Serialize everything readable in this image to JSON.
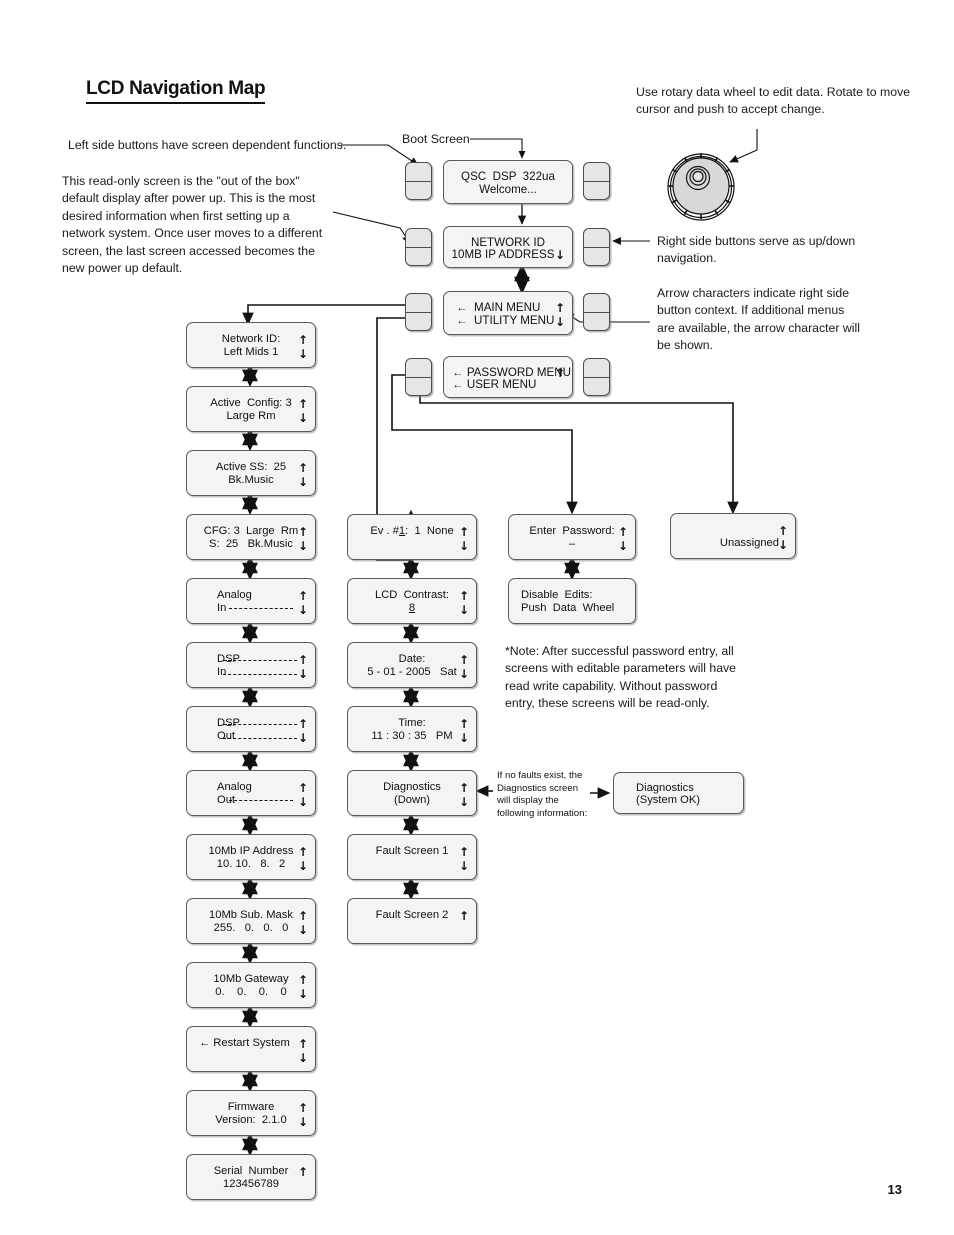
{
  "document": {
    "title": "LCD Navigation Map",
    "page_number": "13"
  },
  "annotations": {
    "left_buttons": "Left side buttons have screen dependent functions.",
    "default_screen": "This read-only screen is the \"out of the box\" default display after power up. This is the most desired information when first setting up a network system. Once user moves to a different screen, the last screen accessed becomes the new power up default.",
    "rotary_wheel": "Use rotary data wheel to edit data. Rotate to move cursor and push to accept change.",
    "right_buttons": "Right side buttons serve as up/down navigation.",
    "arrow_characters": "Arrow characters indicate right side button context. If additional menus are available, the arrow character will be shown.",
    "password_note": "*Note: After successful password entry, all screens with editable parameters will have read write capability. Without password entry, these screens will be read-only.",
    "diagnostics_note": "If no faults exist, the Diagnostics screen will display the following information:",
    "boot_screen_label": "Boot Screen"
  },
  "screens": {
    "boot": {
      "line1": "QSC  DSP  322ua",
      "line2": "Welcome...",
      "up": "",
      "down": ""
    },
    "network_id_menu": {
      "line1": "NETWORK ID",
      "line2": "10MB IP ADDRESS",
      "up": "",
      "down": "↓"
    },
    "main_menu": {
      "line1": "←  MAIN MENU",
      "line2": "←  UTILITY MENU",
      "up": "↑",
      "down": "↓"
    },
    "password_menu": {
      "line1": "← PASSWORD MENU",
      "line2": "← USER MENU",
      "up": "↑",
      "down": ""
    },
    "left_column": [
      {
        "name": "network-id",
        "line1": "Network ID:",
        "line2": "Left Mids 1",
        "up": "↑",
        "down": "↓"
      },
      {
        "name": "active-config",
        "line1": "Active  Config: 3",
        "line2": "Large Rm",
        "up": "↑",
        "down": "↓"
      },
      {
        "name": "active-ss",
        "line1": "Active SS:  25",
        "line2": "Bk.Music",
        "up": "↑",
        "down": "↓"
      },
      {
        "name": "cfg-ss",
        "line1": "CFG: 3  Large  Rm",
        "line2": "S:  25   Bk.Music",
        "up": "↑",
        "down": "↓"
      },
      {
        "name": "analog-in",
        "line1": "Analog",
        "line2": "In",
        "up": "↑",
        "down": "↓",
        "meters": 1
      },
      {
        "name": "dsp-in",
        "line1": "DSP",
        "line2": "In",
        "up": "↑",
        "down": "↓",
        "meters": 2
      },
      {
        "name": "dsp-out",
        "line1": "DSP",
        "line2": "Out",
        "up": "↑",
        "down": "↓",
        "meters": 2
      },
      {
        "name": "analog-out",
        "line1": "Analog",
        "line2": "Out",
        "up": "↑",
        "down": "↓",
        "meters": 1
      },
      {
        "name": "ip-address",
        "line1": "10Mb IP Address",
        "line2": "10. 10.   8.   2",
        "up": "↑",
        "down": "↓"
      },
      {
        "name": "subnet-mask",
        "line1": "10Mb Sub. Mask",
        "line2": "255.   0.   0.   0",
        "up": "↑",
        "down": "↓"
      },
      {
        "name": "gateway",
        "line1": "10Mb Gateway",
        "line2": "0.    0.    0.    0",
        "up": "↑",
        "down": "↓"
      },
      {
        "name": "restart-system",
        "line1": "← Restart System",
        "line2": "",
        "up": "↑",
        "down": "↓"
      },
      {
        "name": "firmware-version",
        "line1": "Firmware",
        "line2": "Version:  2.1.0",
        "up": "↑",
        "down": "↓"
      },
      {
        "name": "serial-number",
        "line1": "Serial  Number",
        "line2": "123456789",
        "up": "↑",
        "down": ""
      }
    ],
    "middle_column": [
      {
        "name": "event-1",
        "line1": "Ev . #1:  1  None",
        "line2": "",
        "up": "↑",
        "down": "↓",
        "underline_token": "1"
      },
      {
        "name": "lcd-contrast",
        "line1": "LCD  Contrast:",
        "line2": "8",
        "up": "↑",
        "down": "↓",
        "underline_token": "8"
      },
      {
        "name": "date",
        "line1": "Date:",
        "line2": "5 - 01 - 2005   Sat",
        "up": "↑",
        "down": "↓"
      },
      {
        "name": "time",
        "line1": "Time:",
        "line2": "11 : 30 : 35   PM",
        "up": "↑",
        "down": "↓"
      },
      {
        "name": "diagnostics",
        "line1": "Diagnostics",
        "line2": "(Down)",
        "up": "↑",
        "down": "↓"
      },
      {
        "name": "fault-screen-1",
        "line1": "Fault Screen 1",
        "line2": "",
        "up": "↑",
        "down": "↓"
      },
      {
        "name": "fault-screen-2",
        "line1": "Fault Screen 2",
        "line2": "",
        "up": "↑",
        "down": ""
      }
    ],
    "right_column": [
      {
        "name": "enter-password",
        "line1": "Enter  Password:",
        "line2": "–",
        "up": "↑",
        "down": "↓"
      },
      {
        "name": "disable-edits",
        "line1": "Disable  Edits:",
        "line2": "Push  Data  Wheel",
        "up": "",
        "down": ""
      }
    ],
    "unassigned": {
      "line1": "",
      "line2": "Unassigned",
      "up": "↑",
      "down": "↓"
    },
    "diagnostics_ok": {
      "line1": "Diagnostics",
      "line2": "(System OK)",
      "up": "",
      "down": ""
    }
  },
  "colors": {
    "lcd_fill": "#f4f4f4",
    "lcd_border": "#5a5a5a",
    "button_fill": "#e6e6e6",
    "ink": "#111111"
  }
}
